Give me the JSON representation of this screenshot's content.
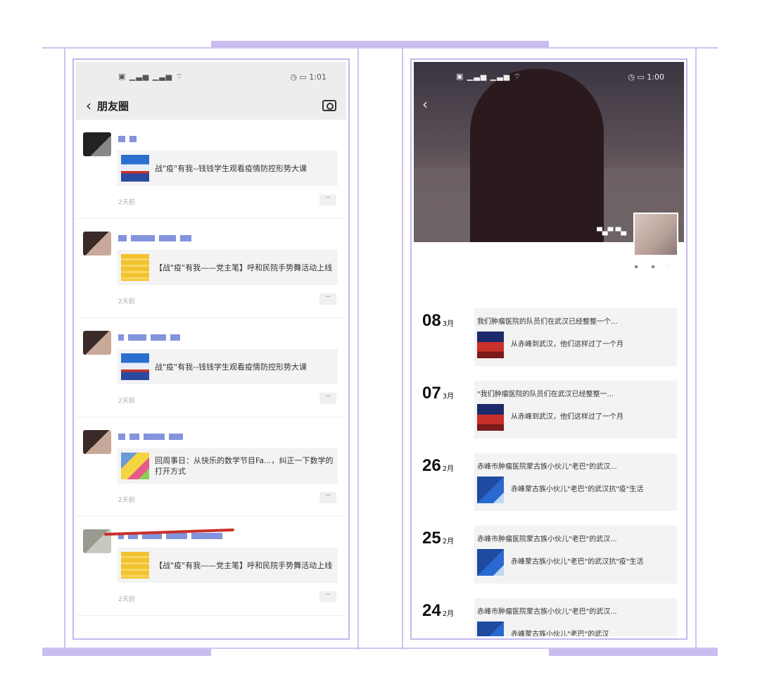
{
  "left": {
    "status_time": "1:01",
    "nav_title": "朋友圈",
    "moments": [
      {
        "share_title": "战\"疫\"有我--钱钱学生观看疫情防控形势大课",
        "time": "2天前",
        "thumb": "blue"
      },
      {
        "share_title": "【战\"疫\"有我——党主笔】呼和民院手势舞活动上线",
        "time": "2天前",
        "thumb": "yellow"
      },
      {
        "share_title": "战\"疫\"有我--钱钱学生观看疫情防控形势大课",
        "time": "2天前",
        "thumb": "blue"
      },
      {
        "share_title": "回周事日：从快乐的数学节目Fa...，纠正一下数学的打开方式",
        "time": "2天前",
        "thumb": "cartoon"
      },
      {
        "share_title": "【战\"疫\"有我——党主笔】呼和民院手势舞活动上线",
        "time": "2天前",
        "thumb": "yellow"
      }
    ]
  },
  "right": {
    "status_time": "1:00",
    "posts": [
      {
        "day": "08",
        "month": "3月",
        "text": "我们肿瘤医院的队员们在武汉已经整整一个...",
        "card_title": "从赤峰到武汉，他们这样过了一个月",
        "thumb": "red"
      },
      {
        "day": "07",
        "month": "3月",
        "text": "\"我们肿瘤医院的队员们在武汉已经整整一...",
        "card_title": "从赤峰到武汉，他们这样过了一个月",
        "thumb": "red"
      },
      {
        "day": "26",
        "month": "2月",
        "text": "赤峰市肿瘤医院蒙古族小伙儿\"老巴\"的武汉...",
        "card_title": "赤峰蒙古族小伙儿\"老巴\"的武汉抗\"疫\"生活",
        "thumb": "navy"
      },
      {
        "day": "25",
        "month": "2月",
        "text": "赤峰市肿瘤医院蒙古族小伙儿\"老巴\"的武汉...",
        "card_title": "赤峰蒙古族小伙儿\"老巴\"的武汉抗\"疫\"生活",
        "thumb": "navy"
      },
      {
        "day": "24",
        "month": "2月",
        "text": "赤峰市肿瘤医院蒙古族小伙儿\"老巴\"的武汉...",
        "card_title": "赤峰蒙古族小伙儿\"老巴\"的武汉",
        "thumb": "navy"
      }
    ]
  },
  "colors": {
    "frame": "#c4b8ee",
    "nick_blur": "#5a6fd0",
    "accent_red": "#c8302a"
  }
}
